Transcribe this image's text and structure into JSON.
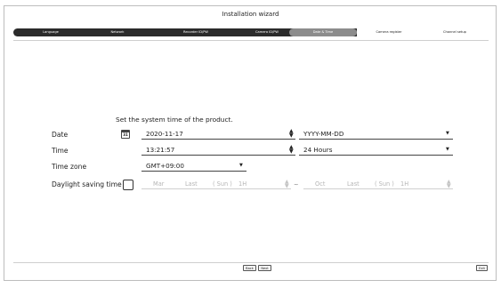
{
  "window": {
    "title": "Installation wizard"
  },
  "steps": [
    {
      "label": "Language"
    },
    {
      "label": "Network"
    },
    {
      "label": "Recorder ID/PW"
    },
    {
      "label": "Camera ID/PW"
    },
    {
      "label": "Date & Time"
    },
    {
      "label": "Camera register"
    },
    {
      "label": "Channel setup"
    }
  ],
  "active_step": "Date & Time",
  "intro": "Set the system time of the product.",
  "date": {
    "label": "Date",
    "value": "2020-11-17",
    "format": "YYYY-MM-DD",
    "calendar_day": "31"
  },
  "time": {
    "label": "Time",
    "value": "13:21:57",
    "format": "24 Hours"
  },
  "timezone": {
    "label": "Time zone",
    "value": "GMT+09:00"
  },
  "dst": {
    "label": "Daylight saving time",
    "enabled": false,
    "start": {
      "month": "Mar",
      "week": "Last",
      "day": "( Sun )",
      "hour": "1H"
    },
    "separator": "~",
    "end": {
      "month": "Oct",
      "week": "Last",
      "day": "( Sun )",
      "hour": "1H"
    }
  },
  "buttons": {
    "back": "Back",
    "next": "Next",
    "exit": "Exit"
  },
  "colors": {
    "step_bar": "#2b2b2b",
    "step_active": "#8c8c8c",
    "text": "#222222"
  },
  "icons": {
    "calendar": "calendar-icon",
    "spinner": "spinner-arrows-icon",
    "dropdown": "dropdown-caret-icon"
  }
}
